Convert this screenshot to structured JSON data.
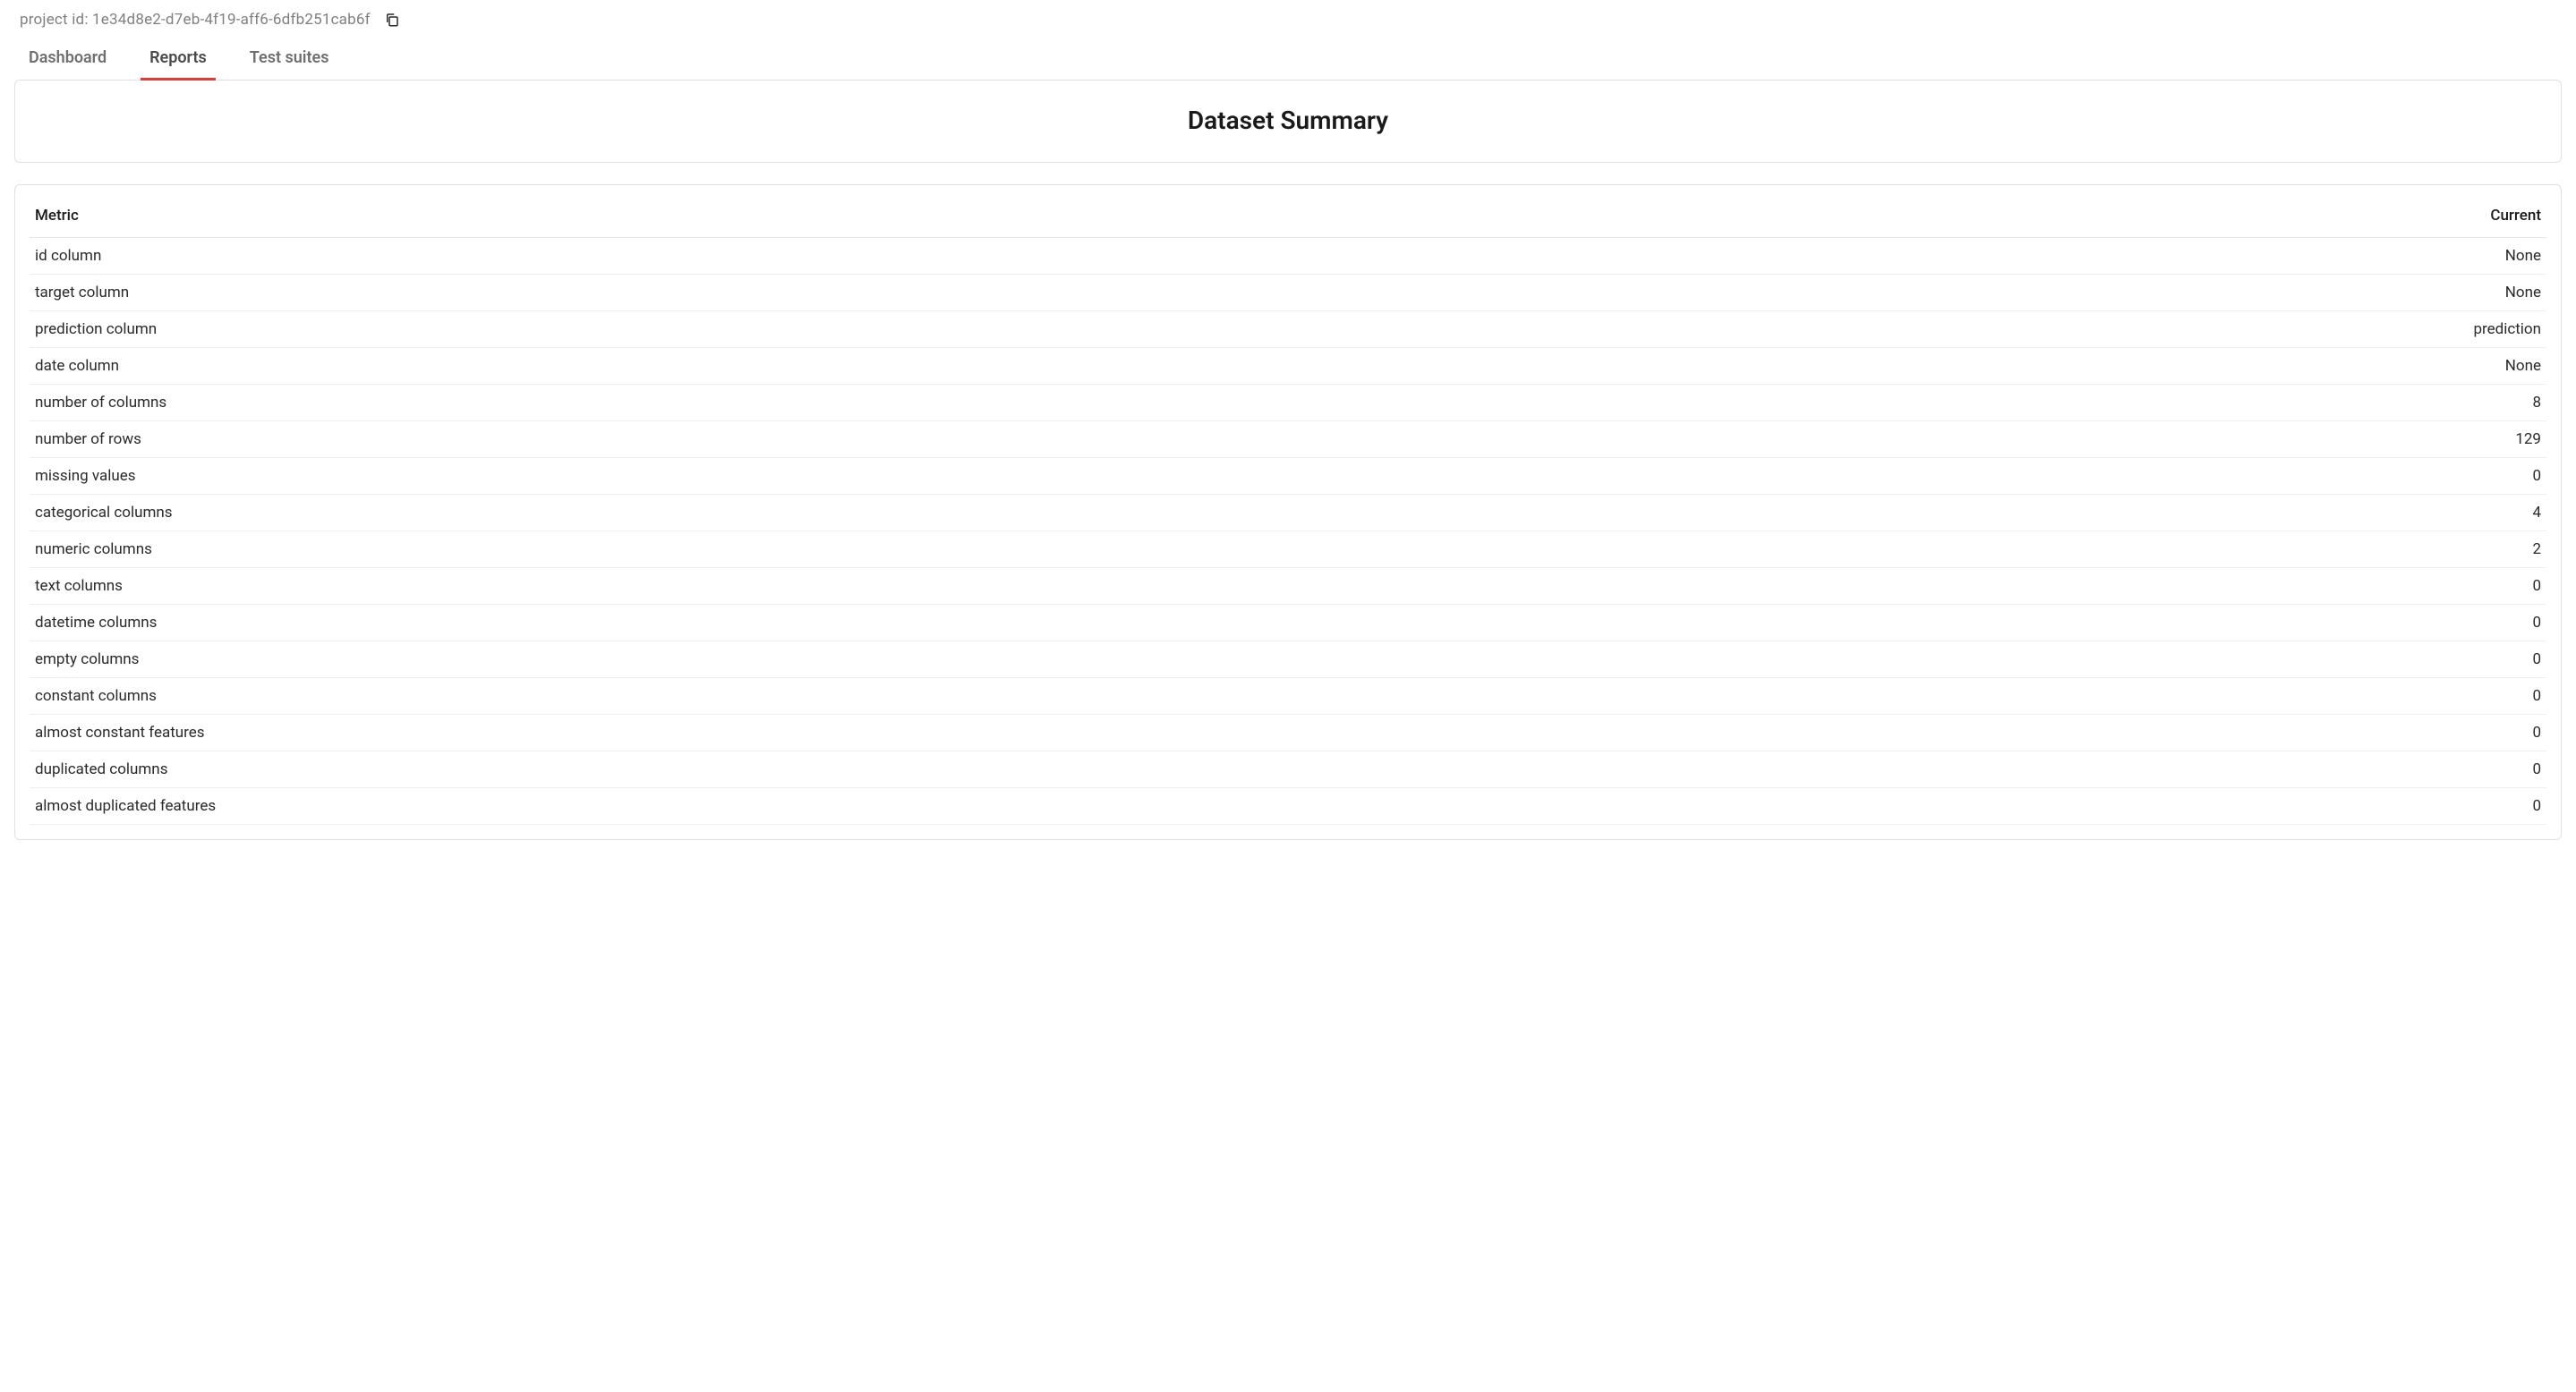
{
  "header": {
    "project_id_label": "project id: 1e34d8e2-d7eb-4f19-aff6-6dfb251cab6f"
  },
  "tabs": [
    {
      "label": "Dashboard",
      "active": false
    },
    {
      "label": "Reports",
      "active": true
    },
    {
      "label": "Test suites",
      "active": false
    }
  ],
  "summary_card": {
    "title": "Dataset Summary"
  },
  "metrics_table": {
    "columns": {
      "metric": "Metric",
      "current": "Current"
    },
    "rows": [
      {
        "metric": "id column",
        "current": "None"
      },
      {
        "metric": "target column",
        "current": "None"
      },
      {
        "metric": "prediction column",
        "current": "prediction"
      },
      {
        "metric": "date column",
        "current": "None"
      },
      {
        "metric": "number of columns",
        "current": "8"
      },
      {
        "metric": "number of rows",
        "current": "129"
      },
      {
        "metric": "missing values",
        "current": "0"
      },
      {
        "metric": "categorical columns",
        "current": "4"
      },
      {
        "metric": "numeric columns",
        "current": "2"
      },
      {
        "metric": "text columns",
        "current": "0"
      },
      {
        "metric": "datetime columns",
        "current": "0"
      },
      {
        "metric": "empty columns",
        "current": "0"
      },
      {
        "metric": "constant columns",
        "current": "0"
      },
      {
        "metric": "almost constant features",
        "current": "0"
      },
      {
        "metric": "duplicated columns",
        "current": "0"
      },
      {
        "metric": "almost duplicated features",
        "current": "0"
      }
    ]
  }
}
